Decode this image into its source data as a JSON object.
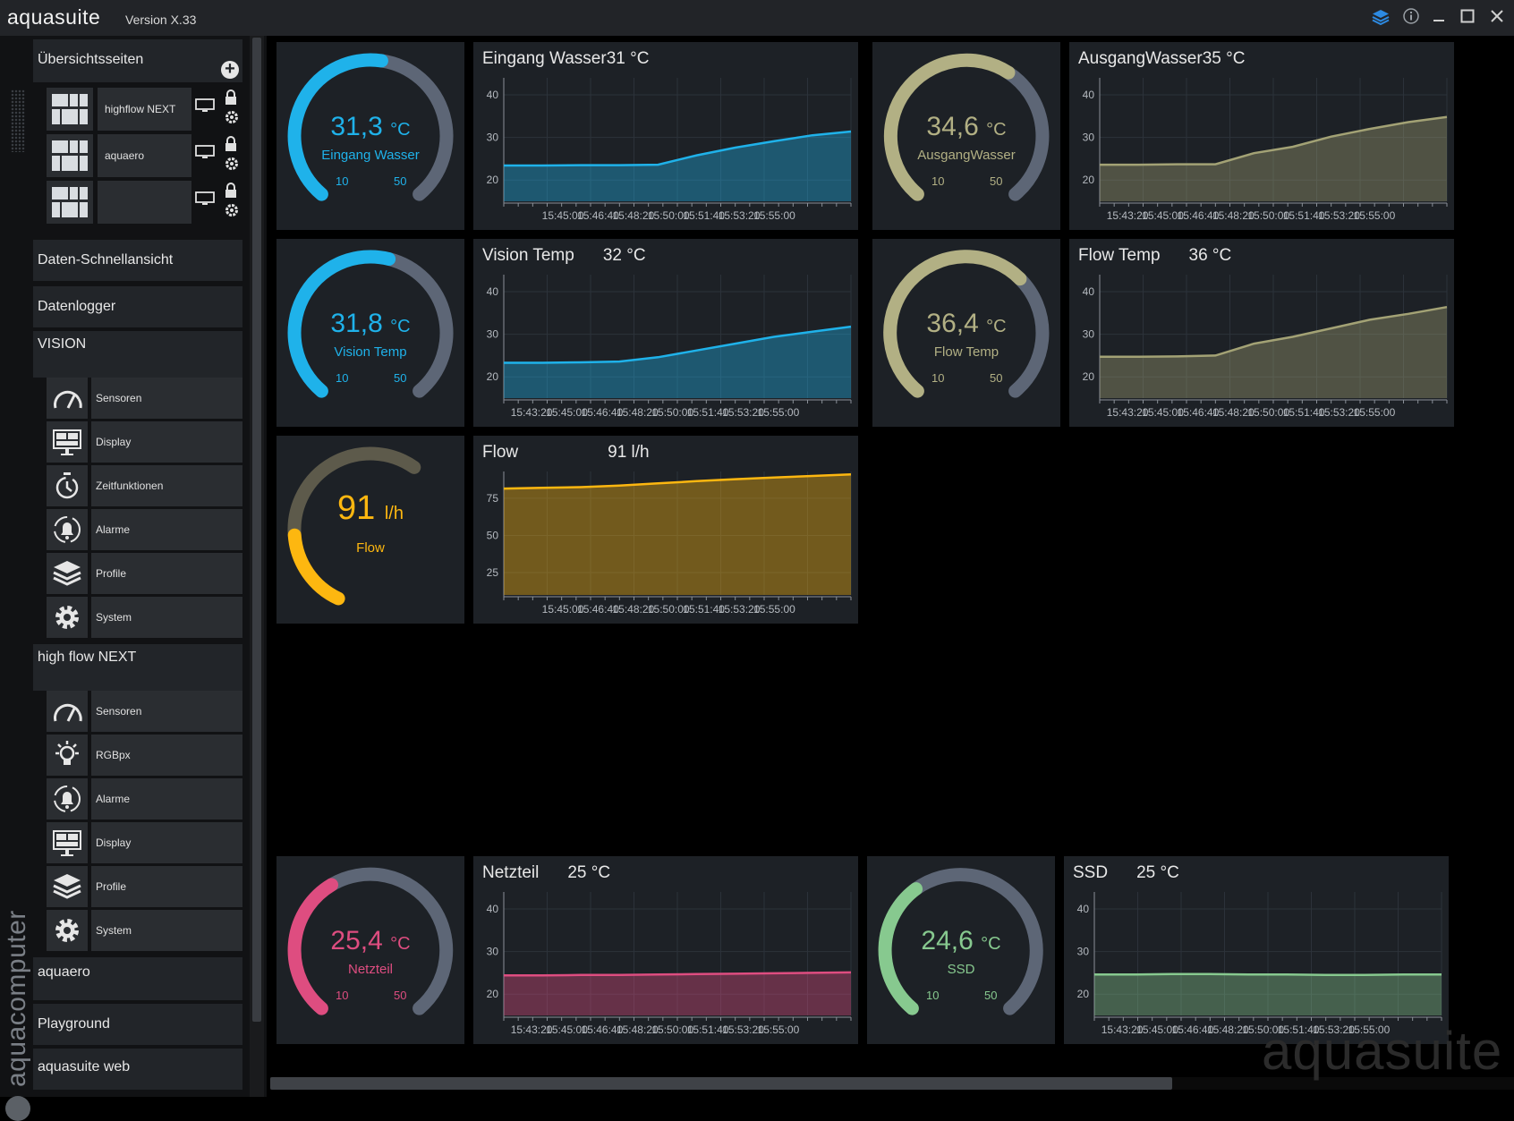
{
  "app": {
    "name": "aquasuite",
    "version": "Version X.33"
  },
  "sidebar": {
    "overview_header": "Übersichtsseiten",
    "overview_pages": [
      {
        "label": "highflow NEXT"
      },
      {
        "label": "aquaero"
      },
      {
        "label": ""
      }
    ],
    "quickview": "Daten-Schnellansicht",
    "datalogger": "Datenlogger",
    "vision": {
      "label": "VISION",
      "items": [
        {
          "label": "Sensoren",
          "icon": "gauge-icon"
        },
        {
          "label": "Display",
          "icon": "display-icon"
        },
        {
          "label": "Zeitfunktionen",
          "icon": "timer-icon"
        },
        {
          "label": "Alarme",
          "icon": "alarm-icon"
        },
        {
          "label": "Profile",
          "icon": "layers-icon"
        },
        {
          "label": "System",
          "icon": "gear-icon"
        }
      ]
    },
    "highflow": {
      "label": "high flow NEXT",
      "items": [
        {
          "label": "Sensoren",
          "icon": "gauge-icon"
        },
        {
          "label": "RGBpx",
          "icon": "bulb-icon"
        },
        {
          "label": "Alarme",
          "icon": "alarm-icon"
        },
        {
          "label": "Display",
          "icon": "display-icon"
        },
        {
          "label": "Profile",
          "icon": "layers-icon"
        },
        {
          "label": "System",
          "icon": "gear-icon"
        }
      ]
    },
    "aquaero": "aquaero",
    "playground": "Playground",
    "web": "aquasuite web",
    "brand": "aquacomputer"
  },
  "gauges": [
    {
      "id": "eingang",
      "value": "31,3",
      "unit": "°C",
      "name": "Eingang Wasser",
      "min": "10",
      "max": "50",
      "level": 0.53,
      "color": "#1fb2ea"
    },
    {
      "id": "ausgang",
      "value": "34,6",
      "unit": "°C",
      "name": "AusgangWasser",
      "min": "10",
      "max": "50",
      "level": 0.62,
      "color": "#b2b084"
    },
    {
      "id": "vision",
      "value": "31,8",
      "unit": "°C",
      "name": "Vision Temp",
      "min": "10",
      "max": "50",
      "level": 0.55,
      "color": "#1fb2ea"
    },
    {
      "id": "flowtemp",
      "value": "36,4",
      "unit": "°C",
      "name": "Flow Temp",
      "min": "10",
      "max": "50",
      "level": 0.66,
      "color": "#b2b084"
    },
    {
      "id": "flow",
      "value": "91",
      "unit": "l/h",
      "name": "Flow",
      "min": "",
      "max": "",
      "level": 0.32,
      "color": "#fdb710"
    },
    {
      "id": "netzteil",
      "value": "25,4",
      "unit": "°C",
      "name": "Netzteil",
      "min": "10",
      "max": "50",
      "level": 0.39,
      "color": "#de4d80"
    },
    {
      "id": "ssd",
      "value": "24,6",
      "unit": "°C",
      "name": "SSD",
      "min": "10",
      "max": "50",
      "level": 0.37,
      "color": "#87c98f"
    }
  ],
  "colors": {
    "background": "#000000",
    "panel": "#1d2126",
    "track": "#5d6676"
  },
  "chart_data": [
    {
      "id": "eingang",
      "type": "area",
      "title": "Eingang Wasser",
      "current": "31 °C",
      "color": "#1fb2ea",
      "x": [
        "15:45:00",
        "15:46:40",
        "15:48:20",
        "15:50:00",
        "15:51:40",
        "15:53:20",
        "15:55:00"
      ],
      "y": [
        23.4,
        23.4,
        23.5,
        23.5,
        23.6,
        25.8,
        27.6,
        29.1,
        30.5,
        31.4
      ],
      "yticks": [
        20,
        30,
        40
      ],
      "ylim": [
        15,
        44
      ]
    },
    {
      "id": "ausgang",
      "type": "area",
      "title": "AusgangWasser",
      "current": "35 °C",
      "color": "#a3a275",
      "x": [
        "15:43:20",
        "15:45:00",
        "15:46:40",
        "15:48:20",
        "15:50:00",
        "15:51:40",
        "15:53:20",
        "15:55:00"
      ],
      "y": [
        23.6,
        23.6,
        23.7,
        23.7,
        26.3,
        27.8,
        30.2,
        32.0,
        33.6,
        34.8
      ],
      "yticks": [
        20,
        30,
        40
      ],
      "ylim": [
        15,
        44
      ]
    },
    {
      "id": "vision",
      "type": "area",
      "title": "Vision Temp",
      "current": "32 °C",
      "color": "#1fb2ea",
      "x": [
        "15:43:20",
        "15:45:00",
        "15:46:40",
        "15:48:20",
        "15:50:00",
        "15:51:40",
        "15:53:20",
        "15:55:00"
      ],
      "y": [
        23.3,
        23.3,
        23.4,
        23.6,
        24.6,
        26.2,
        27.8,
        29.4,
        30.6,
        31.8
      ],
      "yticks": [
        20,
        30,
        40
      ],
      "ylim": [
        15,
        44
      ]
    },
    {
      "id": "flowtemp",
      "type": "area",
      "title": "Flow Temp",
      "current": "36 °C",
      "color": "#a3a275",
      "x": [
        "15:43:20",
        "15:45:00",
        "15:46:40",
        "15:48:20",
        "15:50:00",
        "15:51:40",
        "15:53:20",
        "15:55:00"
      ],
      "y": [
        24.7,
        24.7,
        24.8,
        25.0,
        27.8,
        29.4,
        31.4,
        33.4,
        34.8,
        36.4
      ],
      "yticks": [
        20,
        30,
        40
      ],
      "ylim": [
        15,
        44
      ]
    },
    {
      "id": "flow",
      "type": "area",
      "title": "Flow",
      "current": "91 l/h",
      "color": "#fdb710",
      "x": [
        "15:45:00",
        "15:46:40",
        "15:48:20",
        "15:50:00",
        "15:51:40",
        "15:53:20",
        "15:55:00"
      ],
      "y": [
        81.5,
        82.0,
        82.5,
        83.5,
        85.0,
        86.5,
        87.8,
        89.0,
        90.0,
        91.0
      ],
      "yticks": [
        25,
        50,
        75
      ],
      "ylim": [
        10,
        93
      ]
    },
    {
      "id": "netzteil",
      "type": "area",
      "title": "Netzteil",
      "current": "25 °C",
      "color": "#de4d80",
      "x": [
        "15:43:20",
        "15:45:00",
        "15:46:40",
        "15:48:20",
        "15:50:00",
        "15:51:40",
        "15:53:20",
        "15:55:00"
      ],
      "y": [
        24.4,
        24.4,
        24.5,
        24.5,
        24.6,
        24.7,
        24.8,
        24.9,
        25.0,
        25.1
      ],
      "yticks": [
        20,
        30,
        40
      ],
      "ylim": [
        15,
        44
      ]
    },
    {
      "id": "ssd",
      "type": "area",
      "title": "SSD",
      "current": "25 °C",
      "color": "#87c98f",
      "x": [
        "15:43:20",
        "15:45:00",
        "15:46:40",
        "15:48:20",
        "15:50:00",
        "15:51:40",
        "15:53:20",
        "15:55:00"
      ],
      "y": [
        24.6,
        24.6,
        24.7,
        24.7,
        24.6,
        24.6,
        24.5,
        24.5,
        24.6,
        24.6
      ],
      "yticks": [
        20,
        30,
        40
      ],
      "ylim": [
        15,
        44
      ]
    }
  ],
  "watermark": "aquasuite"
}
